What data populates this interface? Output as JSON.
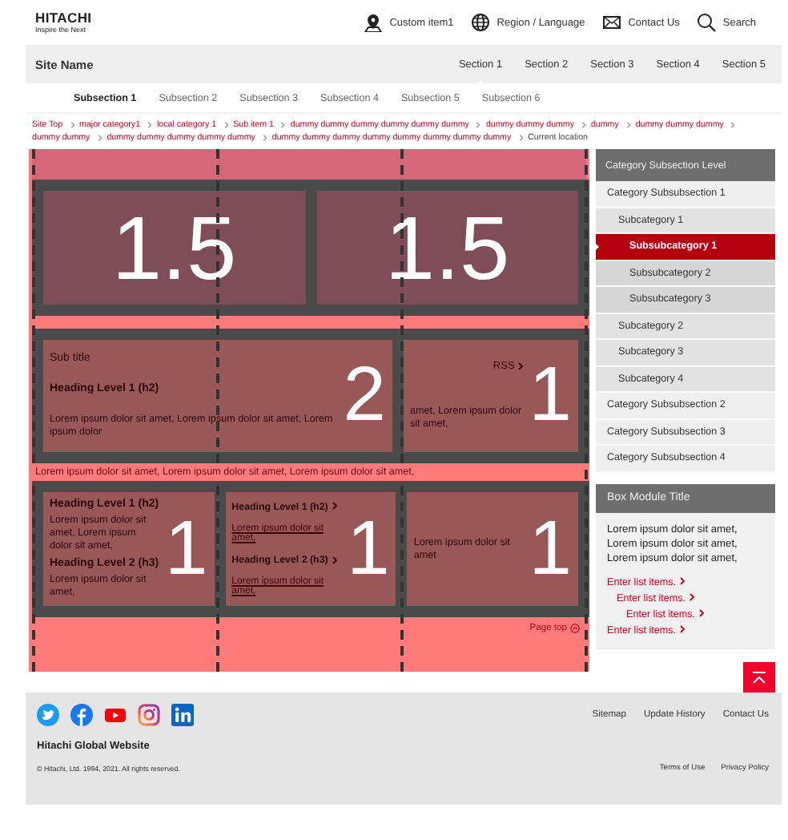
{
  "header": {
    "logo": "HITACHI",
    "tagline": "Inspire the Next",
    "utility_links": [
      {
        "kind": "pin",
        "label": "Custom item1"
      },
      {
        "kind": "globe",
        "label": "Region / Language"
      },
      {
        "kind": "mail",
        "label": "Contact Us"
      },
      {
        "kind": "search",
        "label": "Search"
      }
    ]
  },
  "nav": {
    "site_name": "Site Name",
    "sections": [
      {
        "label": "Section 1",
        "selected": true
      },
      {
        "label": "Section 2",
        "selected": false
      },
      {
        "label": "Section 3",
        "selected": false
      },
      {
        "label": "Section 4",
        "selected": false
      },
      {
        "label": "Section 5",
        "selected": false
      }
    ]
  },
  "subnav": [
    {
      "label": "Subsection 1",
      "selected": true
    },
    {
      "label": "Subsection 2",
      "selected": false
    },
    {
      "label": "Subsection 3",
      "selected": false
    },
    {
      "label": "Subsection 4",
      "selected": false
    },
    {
      "label": "Subsection 5",
      "selected": false
    },
    {
      "label": "Subsection 6",
      "selected": false
    }
  ],
  "breadcrumb": [
    "Site Top",
    "major category1",
    "local category 1",
    "Sub item 1",
    "dummy dummy dummy dummy dummy dummy",
    "dummy dummy dummy",
    "dummy",
    "dummy dummy dummy",
    "dummy dummy",
    "dummy dummy dummy dummy dummy",
    "dummy dummy dummy dummy dummy dummy dummy dummy",
    "Current location"
  ],
  "layout_rows": [
    {
      "kind": "grid",
      "boxes": [
        {
          "span": "1.5"
        },
        {
          "span": "1.5"
        }
      ]
    },
    {
      "kind": "grid",
      "boxes": [
        {
          "span": "2",
          "content": [
            {
              "kind": "subtitle",
              "text": "Sub title"
            },
            {
              "kind": "heading",
              "text": "Heading Level 1 (h2)"
            },
            {
              "kind": "text",
              "text": "Lorem ipsum dolor sit amet, Lorem ipsum dolor sit amet, Lorem ipsum dolor"
            }
          ]
        },
        {
          "span": "1",
          "content": [
            {
              "kind": "rss",
              "text": "RSS"
            },
            {
              "kind": "text",
              "text": "amet, Lorem ipsum dolor sit amet,"
            }
          ]
        }
      ]
    },
    {
      "kind": "text",
      "text": "Lorem ipsum dolor sit amet, Lorem ipsum dolor sit amet, Lorem ipsum dolor sit amet,"
    },
    {
      "kind": "grid",
      "boxes": [
        {
          "span": "1",
          "content": [
            {
              "kind": "heading",
              "text": "Heading Level 1 (h2)"
            },
            {
              "kind": "text",
              "text": "Lorem ipsum dolor sit amet, Lorem ipsum dolor sit amet,"
            },
            {
              "kind": "heading",
              "text": "Heading Level 2 (h3)"
            },
            {
              "kind": "text",
              "text": "Lorem ipsum dolor sit amet,"
            }
          ]
        },
        {
          "span": "1",
          "content": [
            {
              "kind": "link_heading",
              "text": "Heading Level 1 (h2)"
            },
            {
              "kind": "link",
              "text": "Lorem ipsum dolor sit amet,"
            },
            {
              "kind": "link_heading",
              "text": "Heading Level 2 (h3)"
            },
            {
              "kind": "link",
              "text": "Lorem ipsum dolor sit amet,"
            }
          ]
        },
        {
          "span": "1",
          "content": [
            {
              "kind": "text",
              "text": "Lorem ipsum dolor sit amet"
            }
          ]
        }
      ]
    }
  ],
  "page_top": "Page top",
  "sidebar": {
    "title": "Category Subsection Level",
    "items": [
      {
        "label": "Category Subsubsection 1",
        "selected": false,
        "children": [
          {
            "label": "Subcategory 1",
            "selected": false,
            "children": [
              {
                "label": "Subsubcategory 1",
                "selected": true
              },
              {
                "label": "Subsubcategory 2",
                "selected": false
              },
              {
                "label": "Subsubcategory 3",
                "selected": false
              }
            ]
          },
          {
            "label": "Subcategory 2",
            "selected": false
          },
          {
            "label": "Subcategory 3",
            "selected": false
          },
          {
            "label": "Subcategory 4",
            "selected": false
          }
        ]
      },
      {
        "label": "Category Subsubsection 2",
        "selected": false
      },
      {
        "label": "Category Subsubsection 3",
        "selected": false
      },
      {
        "label": "Category Subsubsection 4",
        "selected": false
      }
    ]
  },
  "box_module": {
    "title": "Box Module Title",
    "body": "Lorem ipsum dolor sit amet, Lorem ipsum dolor sit amet, Lorem ipsum dolor sit amet,",
    "links": [
      {
        "label": "Enter list items.",
        "children": [
          {
            "label": "Enter list items.",
            "children": [
              {
                "label": "Enter list items."
              }
            ]
          }
        ]
      },
      {
        "label": "Enter list items."
      }
    ]
  },
  "footer": {
    "links": [
      "Sitemap",
      "Update History",
      "Contact Us"
    ],
    "site": "Hitachi Global Website",
    "copyright": "© Hitachi, Ltd. 1994, 2021. All rights reserved.",
    "legal": [
      "Terms of Use",
      "Privacy Policy"
    ]
  }
}
